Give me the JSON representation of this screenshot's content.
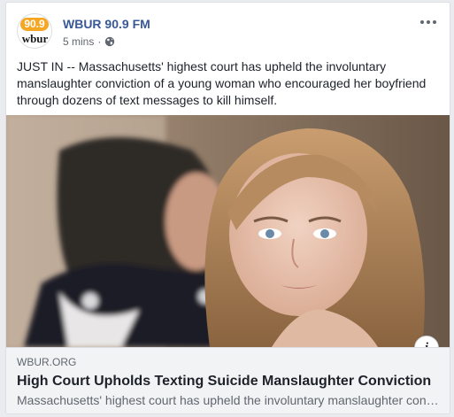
{
  "post": {
    "page_name": "WBUR 90.9 FM",
    "timestamp": "5 mins",
    "separator": "·",
    "privacy_icon": "globe-icon",
    "text": "JUST IN -- Massachusetts' highest court has upheld the involuntary manslaughter conviction of a young woman who encouraged her boyfriend through dozens of text messages to kill himself.",
    "avatar": {
      "logo_number": "90.9",
      "logo_word": "wbur",
      "brand_color": "#f5a623"
    }
  },
  "link_preview": {
    "domain": "WBUR.ORG",
    "title": "High Court Upholds Texting Suicide Manslaughter Conviction",
    "description": "Massachusetts' highest court has upheld the involuntary manslaughter conviction of a young woman who encouraged her boyfriend through dozens of text messages to kill himself.",
    "info_icon": "info-icon",
    "info_label": "i"
  },
  "colors": {
    "page_name": "#385898",
    "text": "#1d2129",
    "meta": "#616770",
    "link_bg": "#f2f3f5"
  }
}
